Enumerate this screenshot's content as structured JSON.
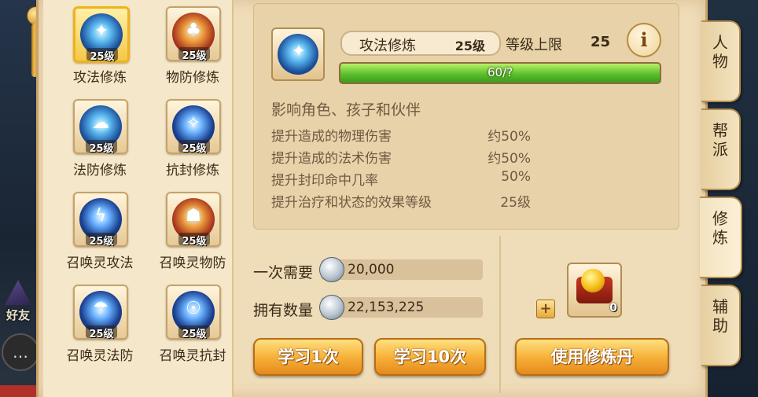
{
  "side": {
    "friends_label": "好友"
  },
  "skills": [
    {
      "name": "攻法修炼",
      "level": "25级",
      "color": "blue",
      "glyph": "✦",
      "selected": true
    },
    {
      "name": "物防修炼",
      "level": "25级",
      "color": "red",
      "glyph": "♣",
      "selected": false
    },
    {
      "name": "法防修炼",
      "level": "25级",
      "color": "blue",
      "glyph": "☁",
      "selected": false
    },
    {
      "name": "抗封修炼",
      "level": "25级",
      "color": "navy",
      "glyph": "✧",
      "selected": false
    },
    {
      "name": "召唤灵攻法",
      "level": "25级",
      "color": "navy",
      "glyph": "ϟ",
      "selected": false
    },
    {
      "name": "召唤灵物防",
      "level": "25级",
      "color": "red",
      "glyph": "☗",
      "selected": false
    },
    {
      "name": "召唤灵法防",
      "level": "25级",
      "color": "navy",
      "glyph": "☂",
      "selected": false
    },
    {
      "name": "召唤灵抗封",
      "level": "25级",
      "color": "navy",
      "glyph": "☉",
      "selected": false
    }
  ],
  "detail": {
    "name": "攻法修炼",
    "level": "25级",
    "max_label": "等级上限",
    "max_value": "25",
    "info_glyph": "i",
    "progress_text": "60/?",
    "progress_fraction": 1.0,
    "affects": "影响角色、孩子和伙伴",
    "effects": [
      {
        "label": "提升造成的物理伤害",
        "value": "约50%"
      },
      {
        "label": "提升造成的法术伤害",
        "value": "约50%"
      },
      {
        "label": "提升封印命中几率",
        "value": "50%"
      },
      {
        "label": "提升治疗和状态的效果等级",
        "value": "25级"
      }
    ]
  },
  "cost": {
    "once_label": "一次需要",
    "once_value": "20,000",
    "own_label": "拥有数量",
    "own_value": "22,153,225",
    "plus": "+"
  },
  "buttons": {
    "learn1": "学习1次",
    "learn10": "学习10次",
    "use_pill": "使用修炼丹"
  },
  "pill": {
    "count": "0"
  },
  "tabs": [
    {
      "label": "人\n物",
      "active": false
    },
    {
      "label": "帮\n派",
      "active": false
    },
    {
      "label": "修\n炼",
      "active": true
    },
    {
      "label": "辅\n助",
      "active": false
    }
  ],
  "colors": {
    "accent": "#f7b23a",
    "progress": "#5cc02c",
    "panel": "#efdcb8"
  }
}
